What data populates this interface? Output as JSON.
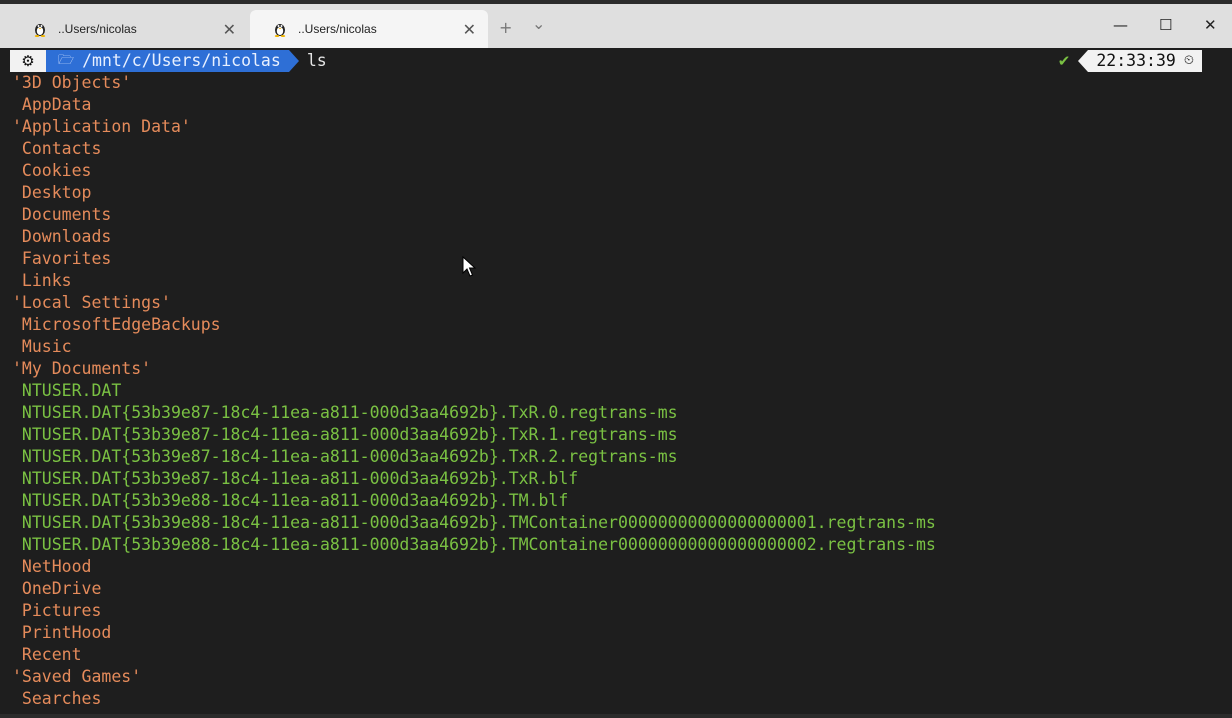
{
  "tabs": [
    {
      "title": "..Users/nicolas",
      "icon": "linux-penguin-icon",
      "active": false
    },
    {
      "title": "..Users/nicolas",
      "icon": "linux-penguin-icon",
      "active": true
    }
  ],
  "tab_controls": {
    "new_tab": "+",
    "dropdown": "⌄"
  },
  "window_controls": {
    "minimize": "—",
    "maximize": "☐",
    "close": "✕"
  },
  "prompt": {
    "os_icon": "⚙",
    "path_icon": "folder-icon",
    "path": "/mnt/c/Users/nicolas",
    "command": "ls",
    "status_icon": "✔",
    "time": "22:33:39",
    "clock_icon": "clock-icon"
  },
  "listing": [
    {
      "name": "'3D Objects'",
      "kind": "dir"
    },
    {
      "name": " AppData",
      "kind": "dir"
    },
    {
      "name": "'Application Data'",
      "kind": "dir"
    },
    {
      "name": " Contacts",
      "kind": "dir"
    },
    {
      "name": " Cookies",
      "kind": "dir"
    },
    {
      "name": " Desktop",
      "kind": "dir"
    },
    {
      "name": " Documents",
      "kind": "dir"
    },
    {
      "name": " Downloads",
      "kind": "dir"
    },
    {
      "name": " Favorites",
      "kind": "dir"
    },
    {
      "name": " Links",
      "kind": "dir"
    },
    {
      "name": "'Local Settings'",
      "kind": "dir"
    },
    {
      "name": " MicrosoftEdgeBackups",
      "kind": "dir"
    },
    {
      "name": " Music",
      "kind": "dir"
    },
    {
      "name": "'My Documents'",
      "kind": "dir"
    },
    {
      "name": " NTUSER.DAT",
      "kind": "file"
    },
    {
      "name": " NTUSER.DAT{53b39e87-18c4-11ea-a811-000d3aa4692b}.TxR.0.regtrans-ms",
      "kind": "file"
    },
    {
      "name": " NTUSER.DAT{53b39e87-18c4-11ea-a811-000d3aa4692b}.TxR.1.regtrans-ms",
      "kind": "file"
    },
    {
      "name": " NTUSER.DAT{53b39e87-18c4-11ea-a811-000d3aa4692b}.TxR.2.regtrans-ms",
      "kind": "file"
    },
    {
      "name": " NTUSER.DAT{53b39e87-18c4-11ea-a811-000d3aa4692b}.TxR.blf",
      "kind": "file"
    },
    {
      "name": " NTUSER.DAT{53b39e88-18c4-11ea-a811-000d3aa4692b}.TM.blf",
      "kind": "file"
    },
    {
      "name": " NTUSER.DAT{53b39e88-18c4-11ea-a811-000d3aa4692b}.TMContainer00000000000000000001.regtrans-ms",
      "kind": "file"
    },
    {
      "name": " NTUSER.DAT{53b39e88-18c4-11ea-a811-000d3aa4692b}.TMContainer00000000000000000002.regtrans-ms",
      "kind": "file"
    },
    {
      "name": " NetHood",
      "kind": "dir"
    },
    {
      "name": " OneDrive",
      "kind": "dir"
    },
    {
      "name": " Pictures",
      "kind": "dir"
    },
    {
      "name": " PrintHood",
      "kind": "dir"
    },
    {
      "name": " Recent",
      "kind": "dir"
    },
    {
      "name": "'Saved Games'",
      "kind": "dir"
    },
    {
      "name": " Searches",
      "kind": "dir"
    }
  ],
  "colors": {
    "directory": "#e58b5b",
    "file": "#7ac143",
    "path_segment": "#2e6fd6",
    "background": "#1e1e1e"
  }
}
